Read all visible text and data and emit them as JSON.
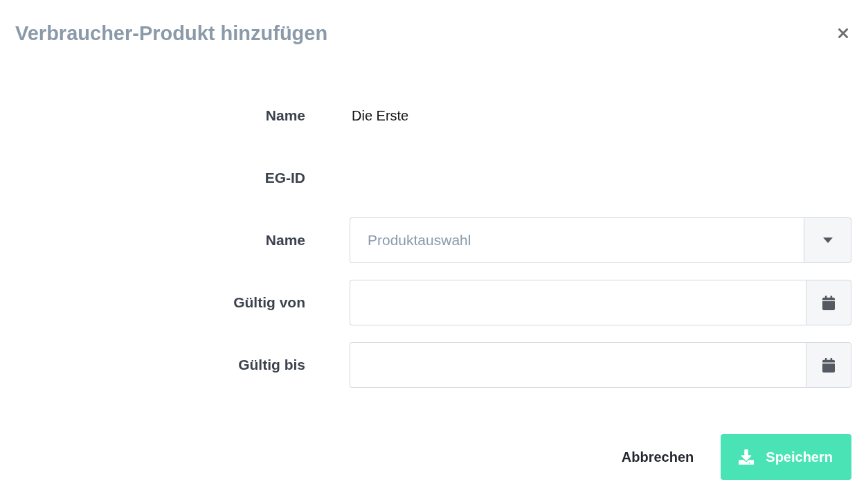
{
  "dialog": {
    "title": "Verbraucher-Produkt hinzufügen"
  },
  "fields": [
    {
      "kind": "static",
      "label": "Name",
      "value": "Die Erste"
    },
    {
      "kind": "static",
      "label": "EG-ID"
    },
    {
      "kind": "select",
      "label": "Name",
      "placeholder": "Produktauswahl"
    },
    {
      "kind": "date",
      "label": "Gültig von"
    },
    {
      "kind": "date",
      "label": "Gültig bis"
    }
  ],
  "buttons": [
    {
      "kind": "secondary",
      "label": "Abbrechen"
    },
    {
      "kind": "primary",
      "label": "Speichern"
    }
  ]
}
